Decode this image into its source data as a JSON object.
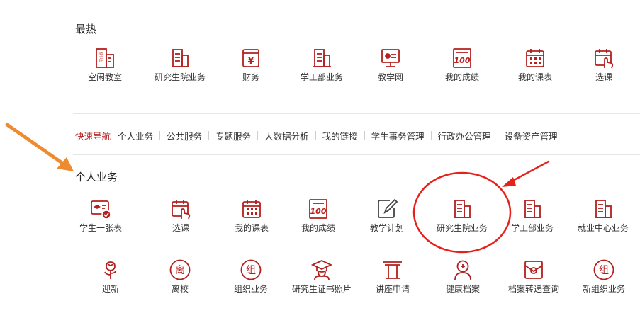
{
  "theme": {
    "accent": "#b3201f",
    "annotation_red": "#e8201a",
    "annotation_orange": "#ef8a2e"
  },
  "hot": {
    "title": "最热",
    "items": [
      {
        "label": "空闲教室",
        "icon": "classroom-icon"
      },
      {
        "label": "研究生院业务",
        "icon": "building-icon"
      },
      {
        "label": "财务",
        "icon": "finance-icon"
      },
      {
        "label": "学工部业务",
        "icon": "building-icon"
      },
      {
        "label": "教学网",
        "icon": "monitor-icon"
      },
      {
        "label": "我的成绩",
        "icon": "score-icon"
      },
      {
        "label": "我的课表",
        "icon": "calendar-icon"
      },
      {
        "label": "选课",
        "icon": "course-select-icon"
      }
    ]
  },
  "quicknav": {
    "items": [
      "快速导航",
      "个人业务",
      "公共服务",
      "专题服务",
      "大数据分析",
      "我的链接",
      "学生事务管理",
      "行政办公管理",
      "设备资产管理"
    ]
  },
  "personal": {
    "title": "个人业务",
    "row1": [
      {
        "label": "学生一张表",
        "icon": "student-card-icon"
      },
      {
        "label": "选课",
        "icon": "course-select-icon"
      },
      {
        "label": "我的课表",
        "icon": "calendar-icon"
      },
      {
        "label": "我的成绩",
        "icon": "score-icon"
      },
      {
        "label": "教学计划",
        "icon": "edit-plan-icon"
      },
      {
        "label": "研究生院业务",
        "icon": "building-icon"
      },
      {
        "label": "学工部业务",
        "icon": "building-icon"
      },
      {
        "label": "就业中心业务",
        "icon": "building-icon"
      }
    ],
    "row2": [
      {
        "label": "迎新",
        "icon": "flower-icon",
        "glyph": ""
      },
      {
        "label": "离校",
        "icon": "leave-school-icon",
        "glyph": "离"
      },
      {
        "label": "组织业务",
        "icon": "organization-icon",
        "glyph": "组"
      },
      {
        "label": "研究生证书照片",
        "icon": "graduate-cap-icon",
        "glyph": ""
      },
      {
        "label": "讲座申请",
        "icon": "lecture-podium-icon",
        "glyph": ""
      },
      {
        "label": "健康档案",
        "icon": "health-icon",
        "glyph": ""
      },
      {
        "label": "档案转递查询",
        "icon": "archive-icon",
        "glyph": ""
      },
      {
        "label": "新组织业务",
        "icon": "new-organization-icon",
        "glyph": "组"
      }
    ]
  }
}
